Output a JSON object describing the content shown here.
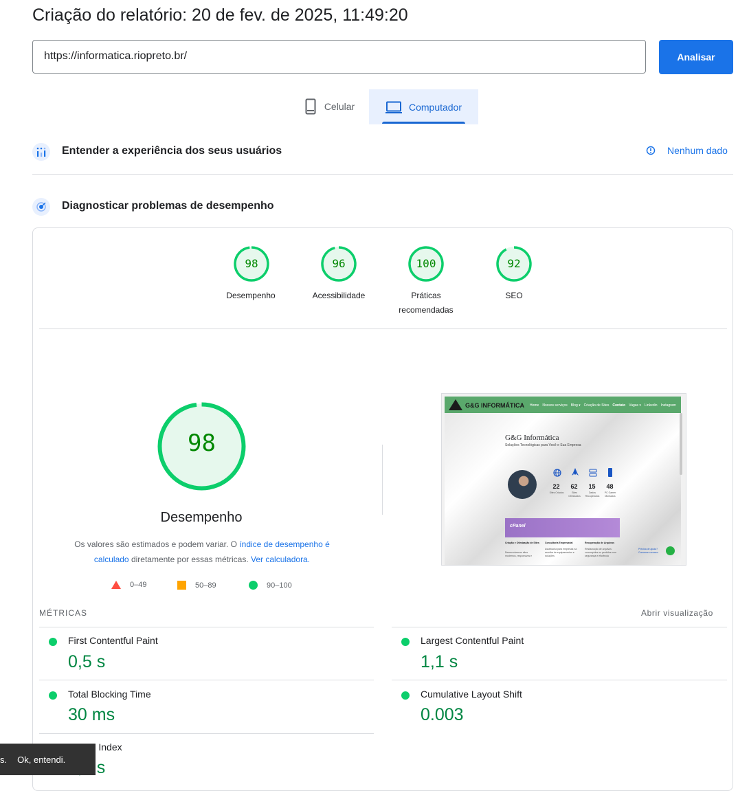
{
  "header": {
    "title": "Criação do relatório: 20 de fev. de 2025, 11:49:20"
  },
  "search": {
    "url_value": "https://informatica.riopreto.br/",
    "analyze_label": "Analisar"
  },
  "tabs": [
    {
      "label": "Celular",
      "icon": "phone-icon"
    },
    {
      "label": "Computador",
      "icon": "laptop-icon",
      "active": true
    }
  ],
  "field_section": {
    "title": "Entender a experiência dos seus usuários",
    "nodata_label": "Nenhum dado"
  },
  "lab_section": {
    "title": "Diagnosticar problemas de desempenho"
  },
  "scores": [
    {
      "value": "98",
      "label": "Desempenho",
      "fraction": 0.98
    },
    {
      "value": "96",
      "label": "Acessibilidade",
      "fraction": 0.96
    },
    {
      "value": "100",
      "label": "Práticas recomendadas",
      "fraction": 1.0
    },
    {
      "value": "92",
      "label": "SEO",
      "fraction": 0.92
    }
  ],
  "performance": {
    "score": "98",
    "score_fraction": 0.98,
    "title": "Desempenho",
    "desc_1": "Os valores são estimados e podem variar. O ",
    "desc_link_1": "índice de desempenho é calculado",
    "desc_2": " diretamente por essas métricas. ",
    "desc_link_2": "Ver calculadora."
  },
  "legend": [
    {
      "range": "0–49",
      "shape": "triangle",
      "color": "#ff4e42"
    },
    {
      "range": "50–89",
      "shape": "square",
      "color": "#ffa400"
    },
    {
      "range": "90–100",
      "shape": "circle",
      "color": "#0cce6b"
    }
  ],
  "screenshot": {
    "brand": "G&G INFORMÁTICA",
    "nav": [
      "Home",
      "Nossos serviços",
      "Blog ▾",
      "Criação de Sites",
      "Contato",
      "Vagas ▾",
      "Linkedin",
      "Instagram"
    ],
    "hero_title": "G&G Informática",
    "hero_subtitle": "Soluções Tecnológicas para Você e Sua Empresa",
    "stats": [
      {
        "num": "22",
        "label": "Sites Criados"
      },
      {
        "num": "62",
        "label": "Sites Otimizados"
      },
      {
        "num": "15",
        "label": "Dados Recuperados"
      },
      {
        "num": "48",
        "label": "PC Gamer Montados"
      }
    ],
    "banner_logo": "cPanel",
    "services": [
      {
        "title": "Criação e Otimização de Sites",
        "text": "Desenvolvemos sites modernos, responsivos e"
      },
      {
        "title": "Consultoria Empresarial",
        "text": "Assessoria para empresas na escolha de equipamentos e soluções"
      },
      {
        "title": "Recuperação de Arquivos",
        "text": "Restauração de arquivos corrompidos ou perdidos com segurança e eficiência"
      }
    ],
    "chat_text": "Precisa de ajuda? Converse conosco"
  },
  "metrics": {
    "heading": "MÉTRICAS",
    "open_view": "Abrir visualização",
    "items": [
      {
        "name": "First Contentful Paint",
        "value": "0,5 s"
      },
      {
        "name": "Largest Contentful Paint",
        "value": "1,1 s"
      },
      {
        "name": "Total Blocking Time",
        "value": "30 ms"
      },
      {
        "name": "Cumulative Layout Shift",
        "value": "0.003"
      },
      {
        "name": "Speed Index",
        "value": "0,6 s"
      }
    ]
  },
  "toast": {
    "prefix": "s.",
    "ok_label": "Ok, entendi."
  },
  "colors": {
    "pass": "#0cce6b",
    "pass_text": "#008800",
    "pass_bg": "#e6f8ed",
    "accent": "#1a73e8"
  }
}
